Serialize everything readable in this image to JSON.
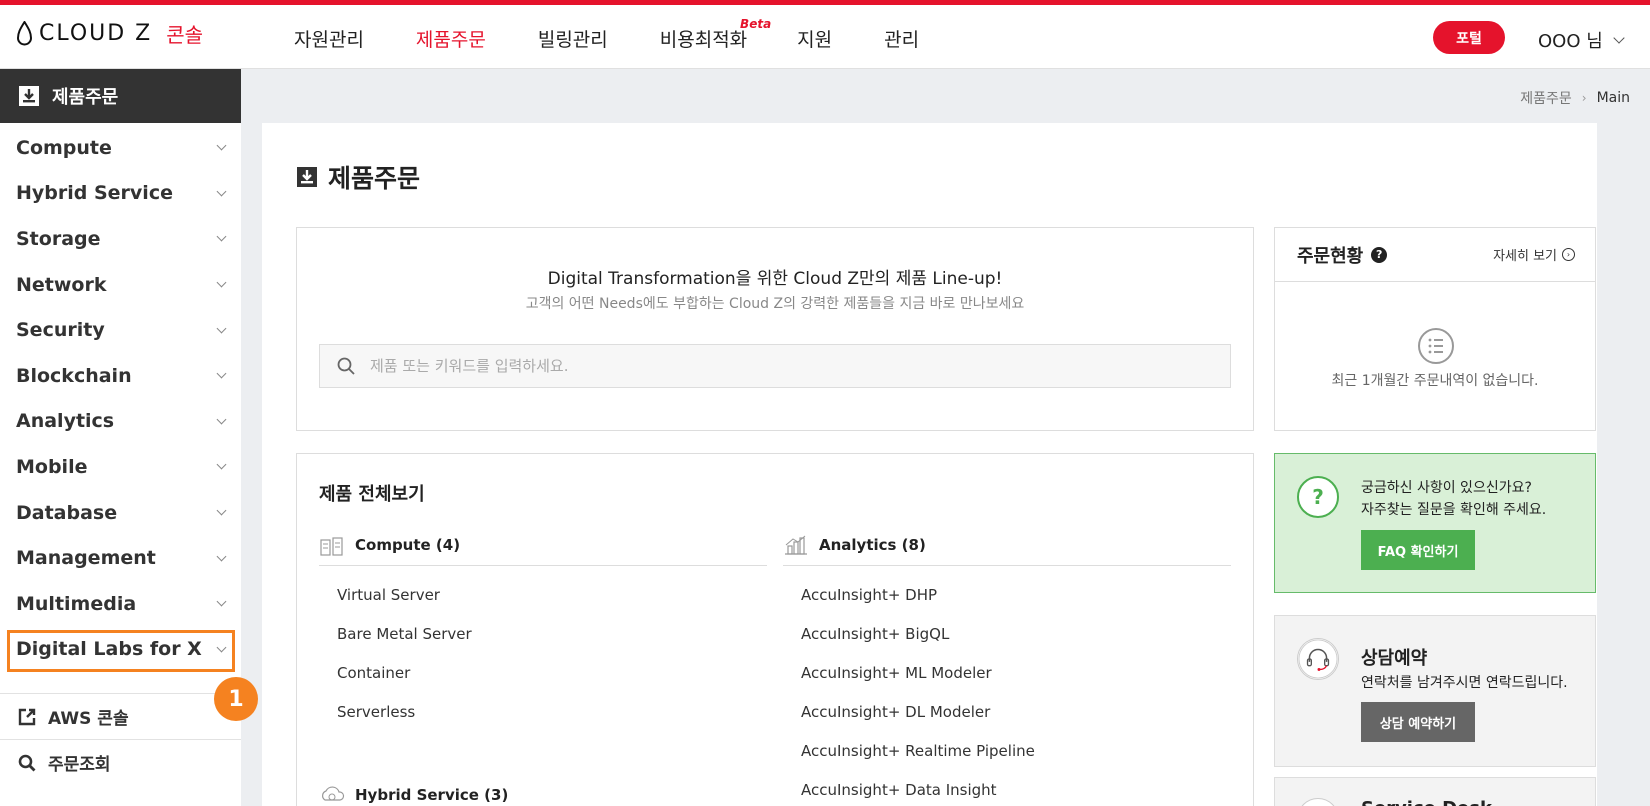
{
  "header": {
    "logo_text": "CLOUD Z",
    "logo_console": "콘솔",
    "nav": [
      {
        "label": "자원관리"
      },
      {
        "label": "제품주문"
      },
      {
        "label": "빌링관리"
      },
      {
        "label": "비용최적화",
        "badge": "Beta"
      },
      {
        "label": "지원"
      },
      {
        "label": "관리"
      }
    ],
    "portal_button": "포털",
    "user_name": "OOO 님",
    "accent_color": "#e5132c"
  },
  "sidebar": {
    "title": "제품주문",
    "items": [
      {
        "label": "Compute"
      },
      {
        "label": "Hybrid Service"
      },
      {
        "label": "Storage"
      },
      {
        "label": "Network"
      },
      {
        "label": "Security"
      },
      {
        "label": "Blockchain"
      },
      {
        "label": "Analytics"
      },
      {
        "label": "Mobile"
      },
      {
        "label": "Database"
      },
      {
        "label": "Management"
      },
      {
        "label": "Multimedia"
      },
      {
        "label": "Digital Labs for X"
      }
    ],
    "links": [
      {
        "label": "AWS 콘솔",
        "icon": "external-link-icon"
      },
      {
        "label": "주문조회",
        "icon": "search-icon"
      }
    ],
    "highlight_badge": "1",
    "highlight_color": "#f58220"
  },
  "breadcrumb": {
    "parent": "제품주문",
    "current": "Main"
  },
  "main": {
    "title": "제품주문",
    "search": {
      "headline": "Digital Transformation을 위한 Cloud Z만의 제품 Line-up!",
      "subline": "고객의 어떤 Needs에도 부합하는 Cloud Z의 강력한 제품들을 지금 바로 만나보세요",
      "placeholder": "제품 또는 키워드를 입력하세요."
    },
    "catalog": {
      "title": "제품 전체보기",
      "compute": {
        "heading": "Compute (4)",
        "items": [
          "Virtual Server",
          "Bare Metal Server",
          "Container",
          "Serverless"
        ]
      },
      "analytics": {
        "heading": "Analytics (8)",
        "items": [
          "AccuInsight+ DHP",
          "AccuInsight+ BigQL",
          "AccuInsight+ ML Modeler",
          "AccuInsight+ DL Modeler",
          "AccuInsight+ Realtime Pipeline",
          "AccuInsight+ Data Insight"
        ]
      },
      "hybrid": {
        "heading": "Hybrid Service (3)"
      }
    }
  },
  "order_status": {
    "title": "주문현황",
    "help": "?",
    "more": "자세히 보기",
    "empty": "최근 1개월간 주문내역이 없습니다."
  },
  "faq": {
    "icon": "?",
    "line1": "궁금하신 사항이 있으신가요?",
    "line2": "자주찾는 질문을 확인해 주세요.",
    "button": "FAQ 확인하기"
  },
  "consult": {
    "title": "상담예약",
    "text": "연락처를 남겨주시면 연락드립니다.",
    "button": "상담 예약하기"
  },
  "service_desk": {
    "title": "Service Desk"
  }
}
